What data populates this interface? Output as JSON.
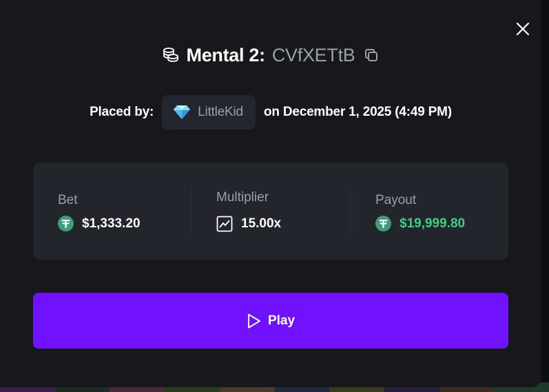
{
  "title": {
    "game": "Mental 2:",
    "bet_id": "CVfXETtB"
  },
  "placed": {
    "label": "Placed by:",
    "username": "LittleKid",
    "date_text": "on December 1, 2025 (4:49 PM)"
  },
  "stats": {
    "bet_label": "Bet",
    "bet_value": "$1,333.20",
    "multiplier_label": "Multiplier",
    "multiplier_value": "15.00x",
    "payout_label": "Payout",
    "payout_value": "$19,999.80"
  },
  "play_button": {
    "label": "Play"
  },
  "colors": {
    "modal_bg": "#17181c",
    "card_bg": "#22252c",
    "accent_purple": "#7112fe",
    "payout_green": "#3fce7f",
    "muted_text": "#9aa0ab",
    "tether_green": "#3e9e7a"
  },
  "icons": [
    "coins-icon",
    "copy-icon",
    "diamond-icon",
    "close-icon",
    "tether-icon",
    "trend-chart-icon",
    "play-icon"
  ]
}
